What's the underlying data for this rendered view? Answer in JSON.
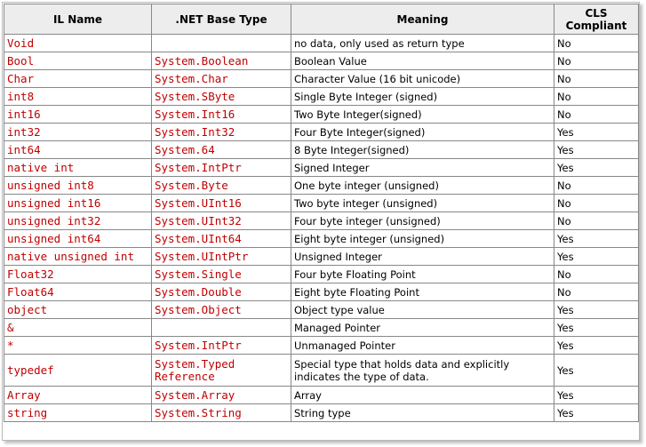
{
  "table": {
    "headers": {
      "il_name": "IL Name",
      "net_type": ".NET Base Type",
      "meaning": "Meaning",
      "cls": "CLS Compliant"
    },
    "rows": [
      {
        "il": "Void",
        "net": "",
        "meaning": "no data, only used as return type",
        "cls": "No"
      },
      {
        "il": "Bool",
        "net": "System.Boolean",
        "meaning": "Boolean Value",
        "cls": "No"
      },
      {
        "il": "Char",
        "net": "System.Char",
        "meaning": "Character Value (16 bit unicode)",
        "cls": "No"
      },
      {
        "il": "int8",
        "net": "System.SByte",
        "meaning": "Single Byte Integer (signed)",
        "cls": "No"
      },
      {
        "il": "int16",
        "net": "System.Int16",
        "meaning": "Two Byte Integer(signed)",
        "cls": "No"
      },
      {
        "il": "int32",
        "net": "System.Int32",
        "meaning": "Four Byte Integer(signed)",
        "cls": "Yes"
      },
      {
        "il": "int64",
        "net": "System.64",
        "meaning": "8 Byte Integer(signed)",
        "cls": "Yes"
      },
      {
        "il": "native int",
        "net": "System.IntPtr",
        "meaning": "Signed Integer",
        "cls": "Yes"
      },
      {
        "il": "unsigned int8",
        "net": "System.Byte",
        "meaning": "One byte integer (unsigned)",
        "cls": "No"
      },
      {
        "il": "unsigned int16",
        "net": "System.UInt16",
        "meaning": "Two byte integer (unsigned)",
        "cls": "No"
      },
      {
        "il": "unsigned int32",
        "net": "System.UInt32",
        "meaning": "Four byte integer (unsigned)",
        "cls": "No"
      },
      {
        "il": "unsigned int64",
        "net": "System.UInt64",
        "meaning": "Eight byte integer (unsigned)",
        "cls": "Yes"
      },
      {
        "il": "native unsigned int",
        "net": "System.UIntPtr",
        "meaning": "Unsigned Integer",
        "cls": "Yes"
      },
      {
        "il": "Float32",
        "net": "System.Single",
        "meaning": "Four byte Floating Point",
        "cls": "No"
      },
      {
        "il": "Float64",
        "net": "System.Double",
        "meaning": "Eight byte Floating Point",
        "cls": "No"
      },
      {
        "il": "object",
        "net": "System.Object",
        "meaning": "Object type value",
        "cls": "Yes"
      },
      {
        "il": "&",
        "net": "",
        "meaning": "Managed Pointer",
        "cls": "Yes"
      },
      {
        "il": "*",
        "net": "System.IntPtr",
        "meaning": "Unmanaged Pointer",
        "cls": "Yes"
      },
      {
        "il": "typedef",
        "net": "System.Typed Reference",
        "meaning": "Special type that holds data and explicitly indicates the type of data.",
        "cls": "Yes"
      },
      {
        "il": "Array",
        "net": "System.Array",
        "meaning": "Array",
        "cls": "Yes"
      },
      {
        "il": "string",
        "net": "System.String",
        "meaning": "String type",
        "cls": "Yes"
      }
    ]
  }
}
